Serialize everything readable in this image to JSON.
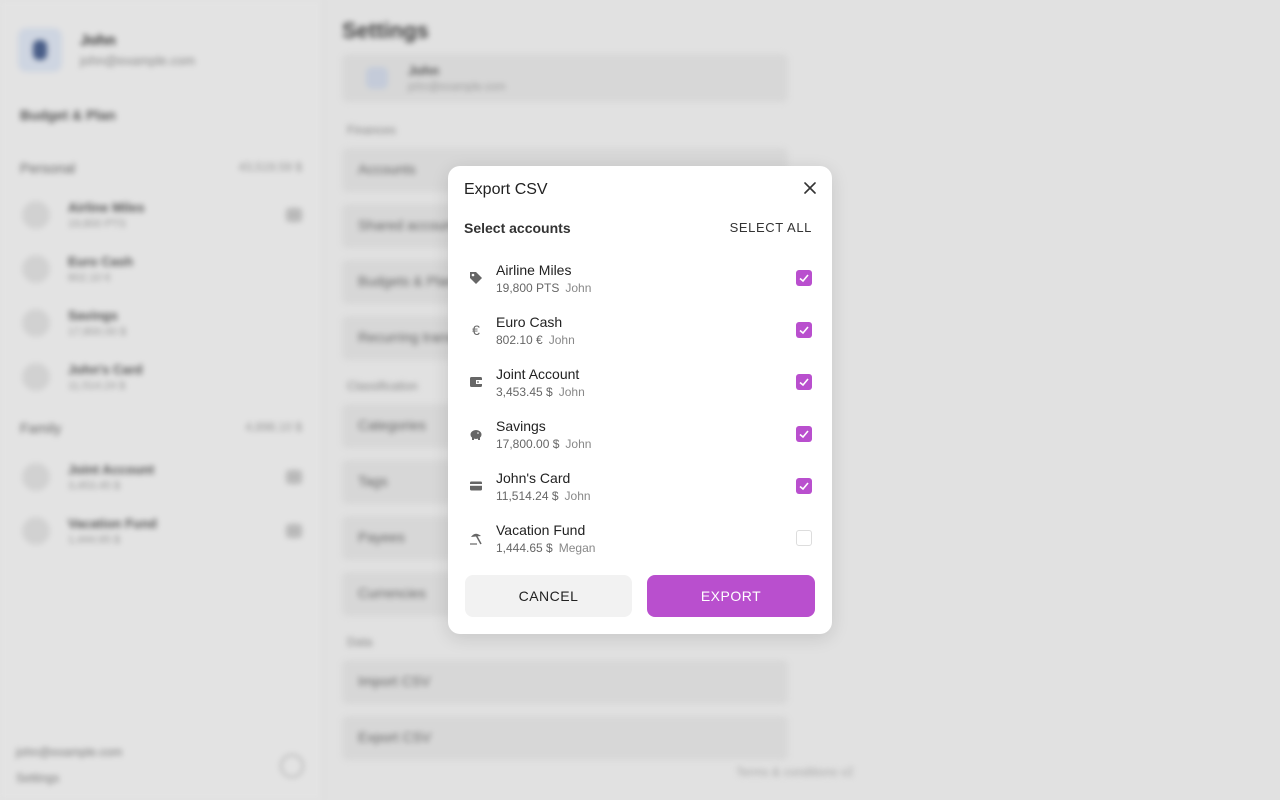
{
  "background": {
    "profile": {
      "name": "John",
      "email": "john@example.com"
    },
    "budget_title": "Budget & Plan",
    "personal_group": {
      "label": "Personal",
      "total": "43,519.59 $"
    },
    "personal_items": [
      {
        "name": "Airline Miles",
        "value": "19,800 PTS"
      },
      {
        "name": "Euro Cash",
        "value": "802.10 €"
      },
      {
        "name": "Savings",
        "value": "17,800.00 $"
      },
      {
        "name": "John's Card",
        "value": "11,514.24 $"
      }
    ],
    "family_group": {
      "label": "Family",
      "total": "4,898.10 $"
    },
    "family_items": [
      {
        "name": "Joint Account",
        "value": "3,453.45 $"
      },
      {
        "name": "Vacation Fund",
        "value": "1,444.65 $"
      }
    ],
    "bottom_line1": "john@example.com",
    "bottom_line2": "Settings",
    "main_title": "Settings",
    "main_profile": {
      "name": "John",
      "email": "john@example.com"
    },
    "sections": [
      {
        "label": "Finances",
        "rows": [
          "Accounts",
          "Shared accounts",
          "Budgets & Plans",
          "Recurring transactions"
        ]
      },
      {
        "label": "Classification",
        "rows": [
          "Categories",
          "Tags",
          "Payees",
          "Currencies"
        ]
      },
      {
        "label": "Data",
        "rows": [
          "Import CSV",
          "Export CSV"
        ]
      }
    ],
    "version": "Terms & conditions   v2"
  },
  "dialog": {
    "title": "Export CSV",
    "select_heading": "Select accounts",
    "select_all_label": "Select all",
    "accounts": [
      {
        "name": "Airline Miles",
        "amount": "19,800 PTS",
        "owner": "John",
        "icon": "tag-icon",
        "checked": true
      },
      {
        "name": "Euro Cash",
        "amount": "802.10 €",
        "owner": "John",
        "icon": "euro-icon",
        "checked": true
      },
      {
        "name": "Joint Account",
        "amount": "3,453.45 $",
        "owner": "John",
        "icon": "wallet-icon",
        "checked": true
      },
      {
        "name": "Savings",
        "amount": "17,800.00 $",
        "owner": "John",
        "icon": "piggy-bank-icon",
        "checked": true
      },
      {
        "name": "John's Card",
        "amount": "11,514.24 $",
        "owner": "John",
        "icon": "credit-card-icon",
        "checked": true
      },
      {
        "name": "Vacation Fund",
        "amount": "1,444.65 $",
        "owner": "Megan",
        "icon": "beach-umbrella-icon",
        "checked": false
      }
    ],
    "cancel_label": "Cancel",
    "export_label": "Export"
  },
  "colors": {
    "accent": "#b94fce",
    "cancel_bg": "#f2f2f2"
  }
}
